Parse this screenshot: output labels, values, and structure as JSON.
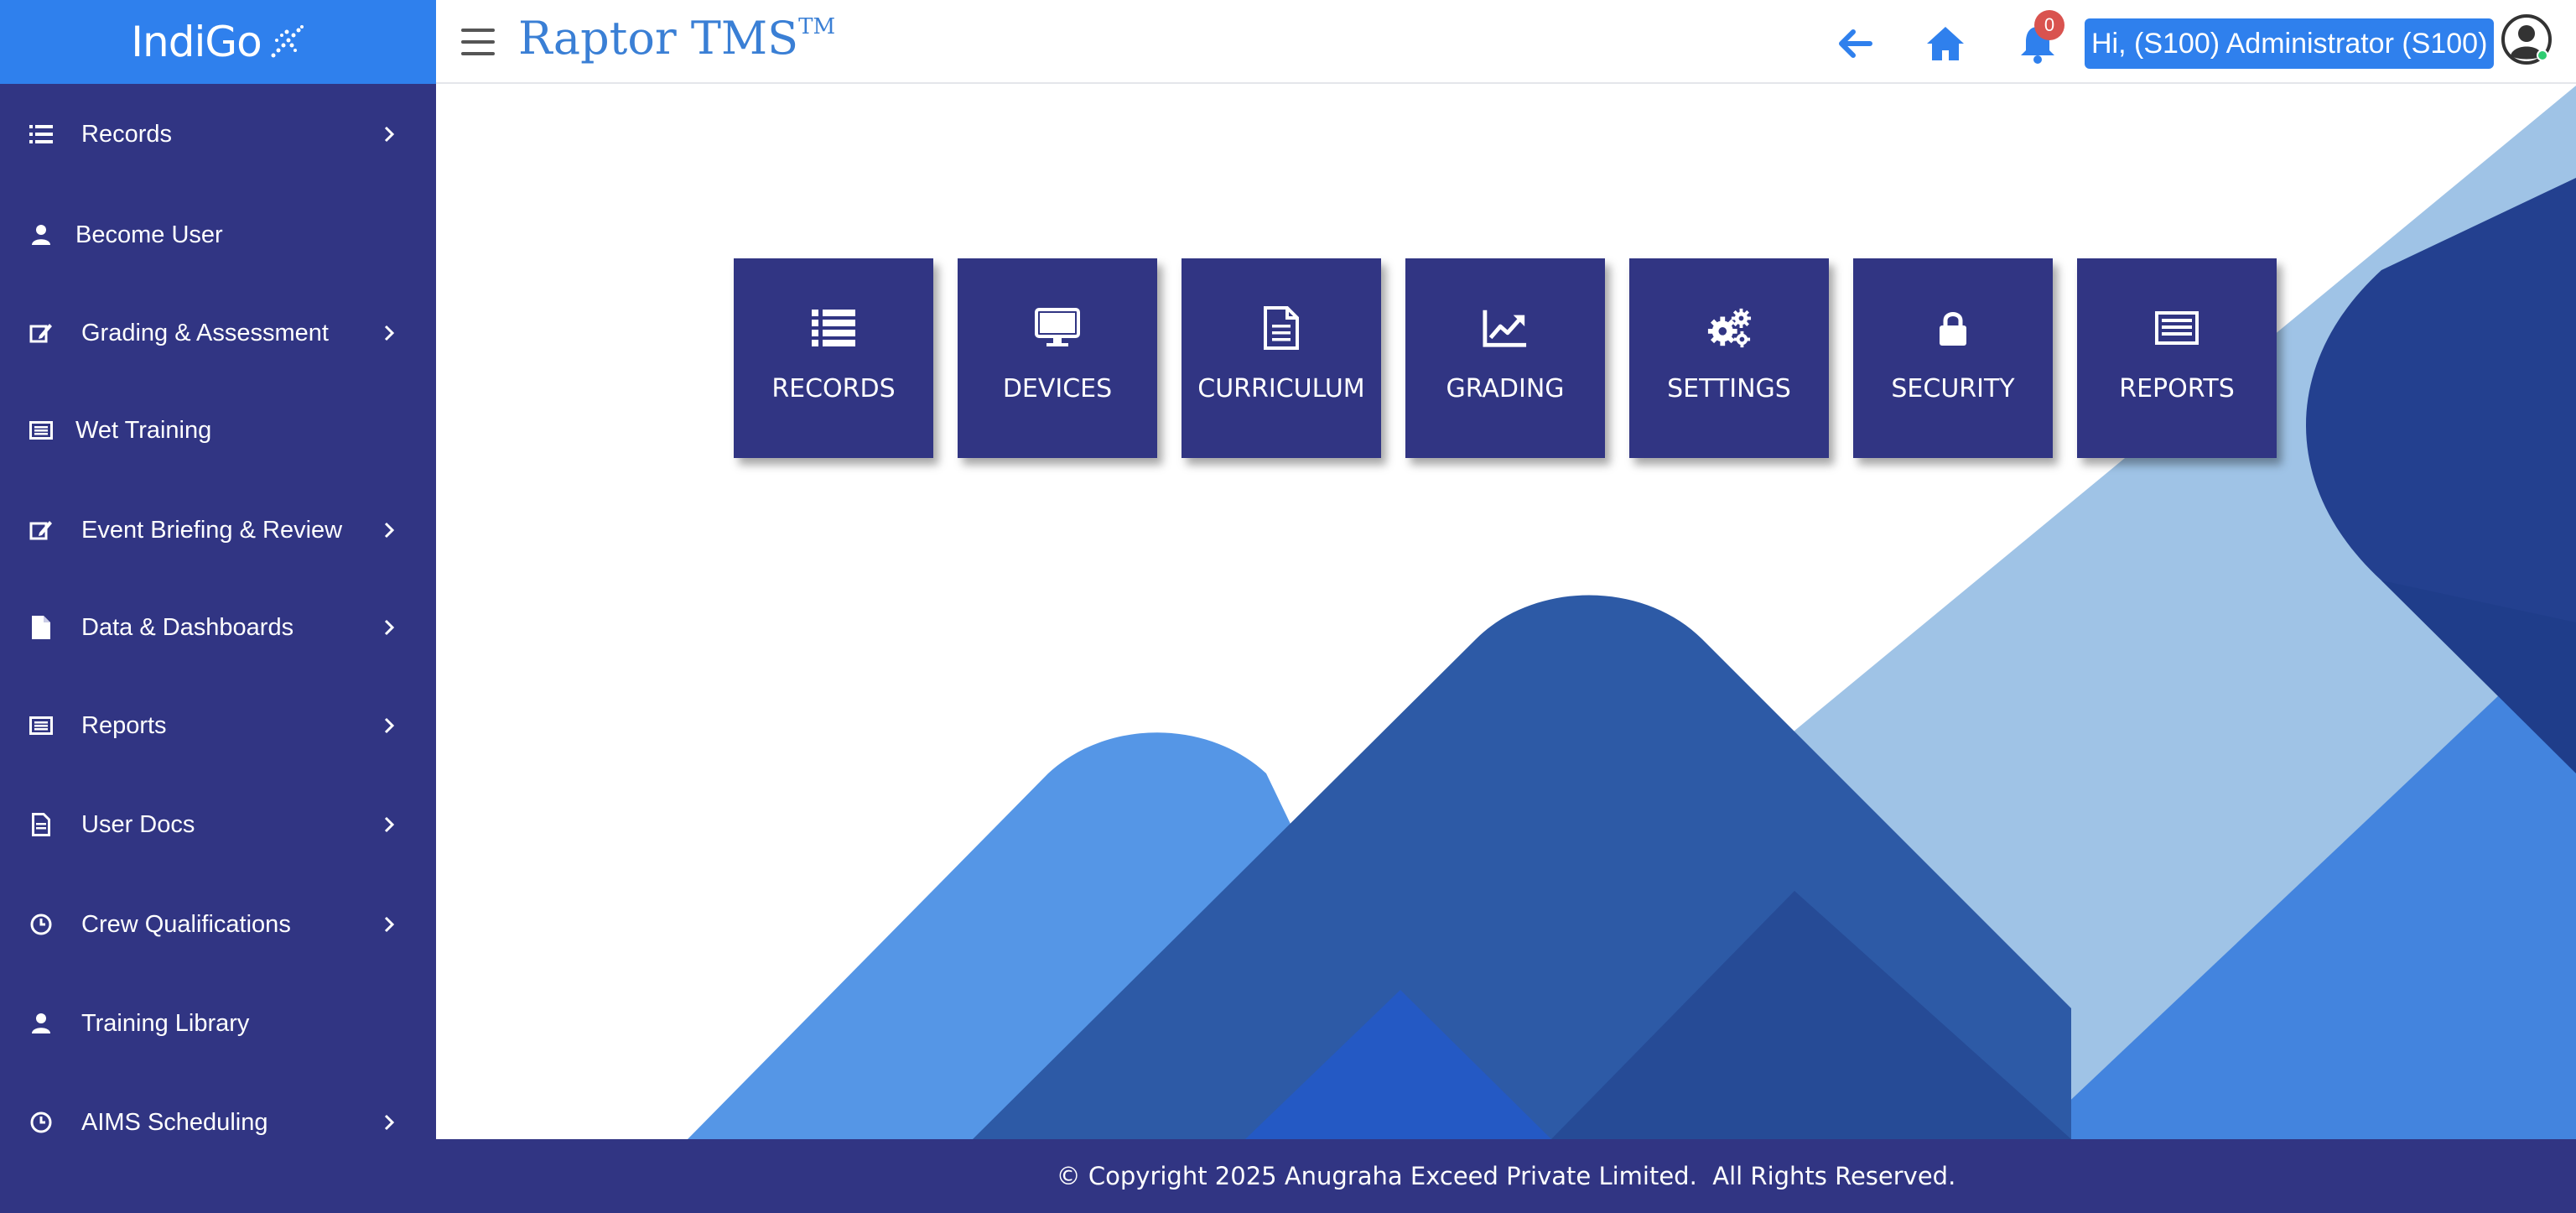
{
  "sidebar": {
    "logo_text": "IndiGo",
    "items": [
      {
        "label": "Records",
        "icon": "list-icon",
        "has_submenu": true
      },
      {
        "label": "Become User",
        "icon": "user-icon",
        "has_submenu": false
      },
      {
        "label": "Grading & Assessment",
        "icon": "edit-icon",
        "has_submenu": true
      },
      {
        "label": "Wet Training",
        "icon": "newspaper-icon",
        "has_submenu": false
      },
      {
        "label": "Event Briefing & Review",
        "icon": "edit-icon",
        "has_submenu": true
      },
      {
        "label": "Data & Dashboards",
        "icon": "file-icon",
        "has_submenu": true
      },
      {
        "label": "Reports",
        "icon": "newspaper-icon",
        "has_submenu": true
      },
      {
        "label": "User Docs",
        "icon": "document-icon",
        "has_submenu": true
      },
      {
        "label": "Crew Qualifications",
        "icon": "clock-icon",
        "has_submenu": true
      },
      {
        "label": "Training Library",
        "icon": "user-icon",
        "has_submenu": false
      },
      {
        "label": "AIMS Scheduling",
        "icon": "clock-icon",
        "has_submenu": true
      }
    ]
  },
  "header": {
    "brand": "Raptor TMS",
    "brand_tm": "TM",
    "notification_count": "0",
    "user_greeting": "Hi, (S100) Administrator (S100)"
  },
  "tiles": [
    {
      "label": "RECORDS",
      "icon": "list-icon"
    },
    {
      "label": "DEVICES",
      "icon": "monitor-icon"
    },
    {
      "label": "CURRICULUM",
      "icon": "document-icon"
    },
    {
      "label": "GRADING",
      "icon": "chart-line-icon"
    },
    {
      "label": "SETTINGS",
      "icon": "gears-icon"
    },
    {
      "label": "SECURITY",
      "icon": "lock-icon"
    },
    {
      "label": "REPORTS",
      "icon": "newspaper-icon"
    }
  ],
  "footer": {
    "copyright": "© Copyright 2025 Anugraha Exceed Private Limited.  All Rights Reserved."
  },
  "colors": {
    "sidebar_bg": "#313583",
    "accent_blue": "#2f80ed",
    "tile_bg": "#313583",
    "badge_red": "#d9534f"
  }
}
